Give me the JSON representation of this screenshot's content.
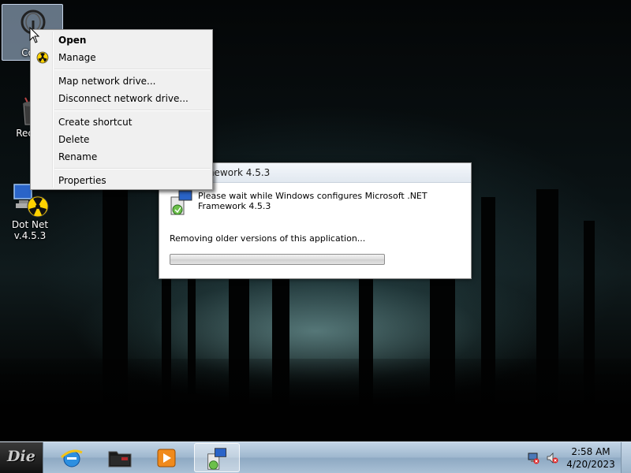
{
  "desktop": {
    "icons": [
      {
        "label": "Com"
      },
      {
        "label": "Recyc"
      },
      {
        "label": "Dot Net v.4.5.3"
      }
    ]
  },
  "context_menu": {
    "items": [
      {
        "label": "Open",
        "bold": true
      },
      {
        "label": "Manage",
        "icon": "shield-icon"
      },
      {
        "label": "Map network drive..."
      },
      {
        "label": "Disconnect network drive..."
      },
      {
        "label": "Create shortcut"
      },
      {
        "label": "Delete"
      },
      {
        "label": "Rename"
      },
      {
        "label": "Properties"
      }
    ]
  },
  "dialog": {
    "title": ".NET Framework 4.5.3",
    "message": "Please wait while Windows configures Microsoft .NET Framework 4.5.3",
    "status": "Removing older versions of this application...",
    "progress": 0.0
  },
  "taskbar": {
    "start_logo": "Die",
    "pinned": [
      "internet-explorer-icon",
      "folder-icon",
      "media-player-icon",
      "setup-icon"
    ],
    "clock": {
      "time": "2:58 AM",
      "date": "4/20/2023"
    }
  },
  "colors": {
    "taskbar": "#a9c0d5",
    "menu_bg": "#f0f0f0",
    "progress_green": "#3aa52c"
  }
}
